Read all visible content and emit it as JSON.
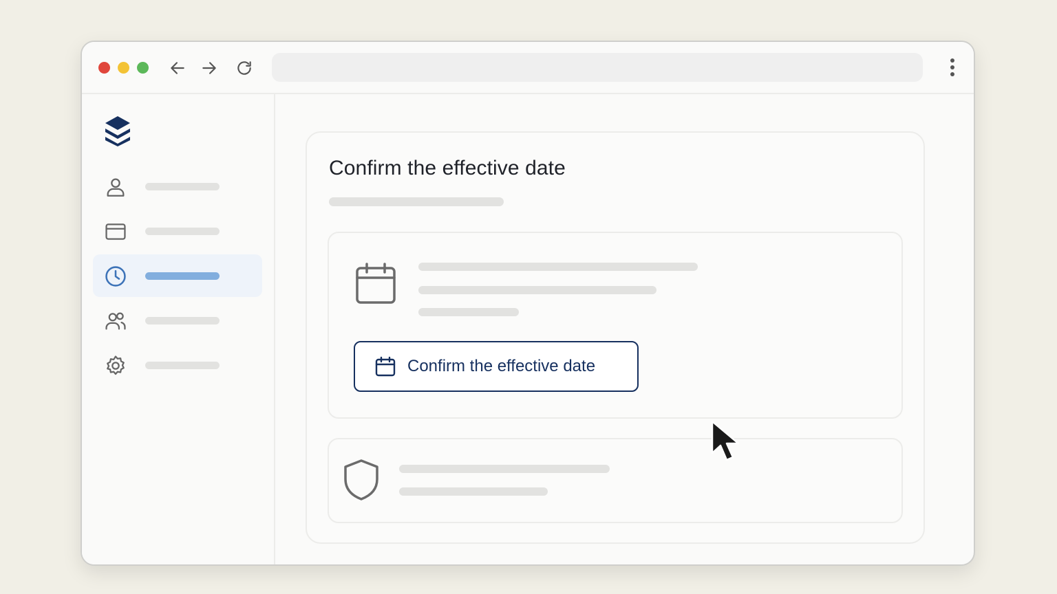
{
  "page": {
    "title": "Confirm the effective date"
  },
  "action_button": {
    "label": "Confirm the effective date",
    "icon": "calendar-icon"
  },
  "sidebar": {
    "logo_icon": "stacked-layers-logo-icon",
    "active_index": 2,
    "items": [
      {
        "icon": "user-icon"
      },
      {
        "icon": "credit-card-icon"
      },
      {
        "icon": "clock-icon"
      },
      {
        "icon": "users-icon"
      },
      {
        "icon": "gear-icon"
      }
    ]
  },
  "colors": {
    "accent": "#16305f",
    "active_highlight": "#82aede",
    "active_bg": "#eef3fa",
    "traffic_red": "#e0463c",
    "traffic_yellow": "#f3c336",
    "traffic_green": "#5cb85a"
  }
}
